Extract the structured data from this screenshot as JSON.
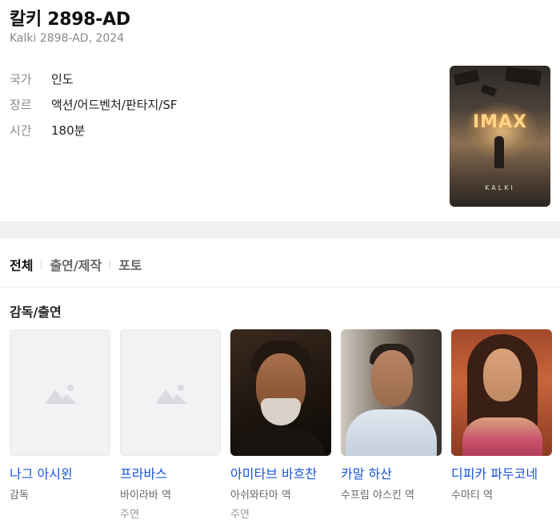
{
  "movie": {
    "title": "칼키 2898-AD",
    "subtitle": "Kalki 2898-AD, 2024",
    "meta": [
      {
        "key": "국가",
        "value": "인도"
      },
      {
        "key": "장르",
        "value": "액션/어드벤처/판타지/SF"
      },
      {
        "key": "시간",
        "value": "180분"
      }
    ],
    "poster": {
      "imax_text": "IMAX",
      "title_text": "KALKI"
    }
  },
  "tabs": [
    {
      "label": "전체",
      "active": true
    },
    {
      "label": "출연/제작",
      "active": false
    },
    {
      "label": "포토",
      "active": false
    }
  ],
  "section_title": "감독/출연",
  "cast": [
    {
      "name": "나그 아시윈",
      "role": "감독",
      "role2": "",
      "photo": "placeholder"
    },
    {
      "name": "프라바스",
      "role": "바이라바 역",
      "role2": "주연",
      "photo": "placeholder"
    },
    {
      "name": "아미타브 바흐찬",
      "role": "아쉬와타마 역",
      "role2": "주연",
      "photo": "portrait"
    },
    {
      "name": "카말 하산",
      "role": "수프림 야스킨 역",
      "role2": "",
      "photo": "portrait"
    },
    {
      "name": "디피카 파두코네",
      "role": "수마티 역",
      "role2": "",
      "photo": "portrait"
    }
  ],
  "colors": {
    "link": "#1a55d8",
    "muted": "#888888",
    "gap": "#f0f1f3"
  }
}
